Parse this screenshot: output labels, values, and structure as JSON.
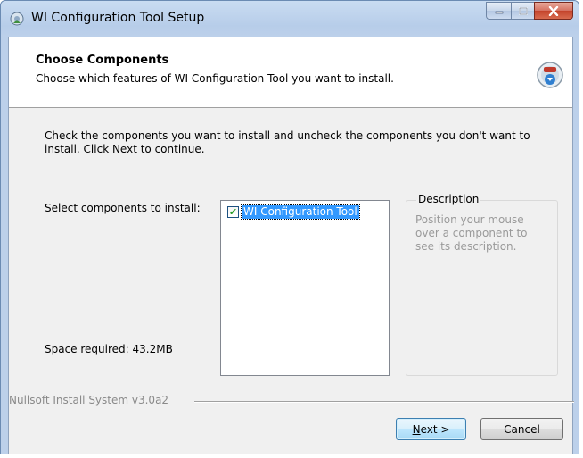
{
  "window": {
    "title": "WI Configuration Tool Setup",
    "icon": "installer-app-icon",
    "caption_buttons": [
      "minimize-icon",
      "maximize-icon",
      "close-icon"
    ]
  },
  "header": {
    "title": "Choose Components",
    "subtitle": "Choose which features of WI Configuration Tool you want to install.",
    "icon": "install-disc-icon"
  },
  "body": {
    "intro": "Check the components you want to install and uncheck the components you don't want to install. Click Next to continue.",
    "select_label": "Select components to install:",
    "space_required": "Space required: 43.2MB",
    "components": [
      {
        "label": "WI Configuration Tool",
        "checked": true,
        "selected": true
      }
    ],
    "description": {
      "title": "Description",
      "text": "Position your mouse over a component to see its description."
    }
  },
  "footer": {
    "branding": "Nullsoft Install System v3.0a2",
    "next_label_prefix": "N",
    "next_label_rest": "ext >",
    "cancel_label": "Cancel"
  },
  "colors": {
    "selection": "#3399ff",
    "check": "#2a9d2a",
    "description_text": "#9a9a9a"
  }
}
